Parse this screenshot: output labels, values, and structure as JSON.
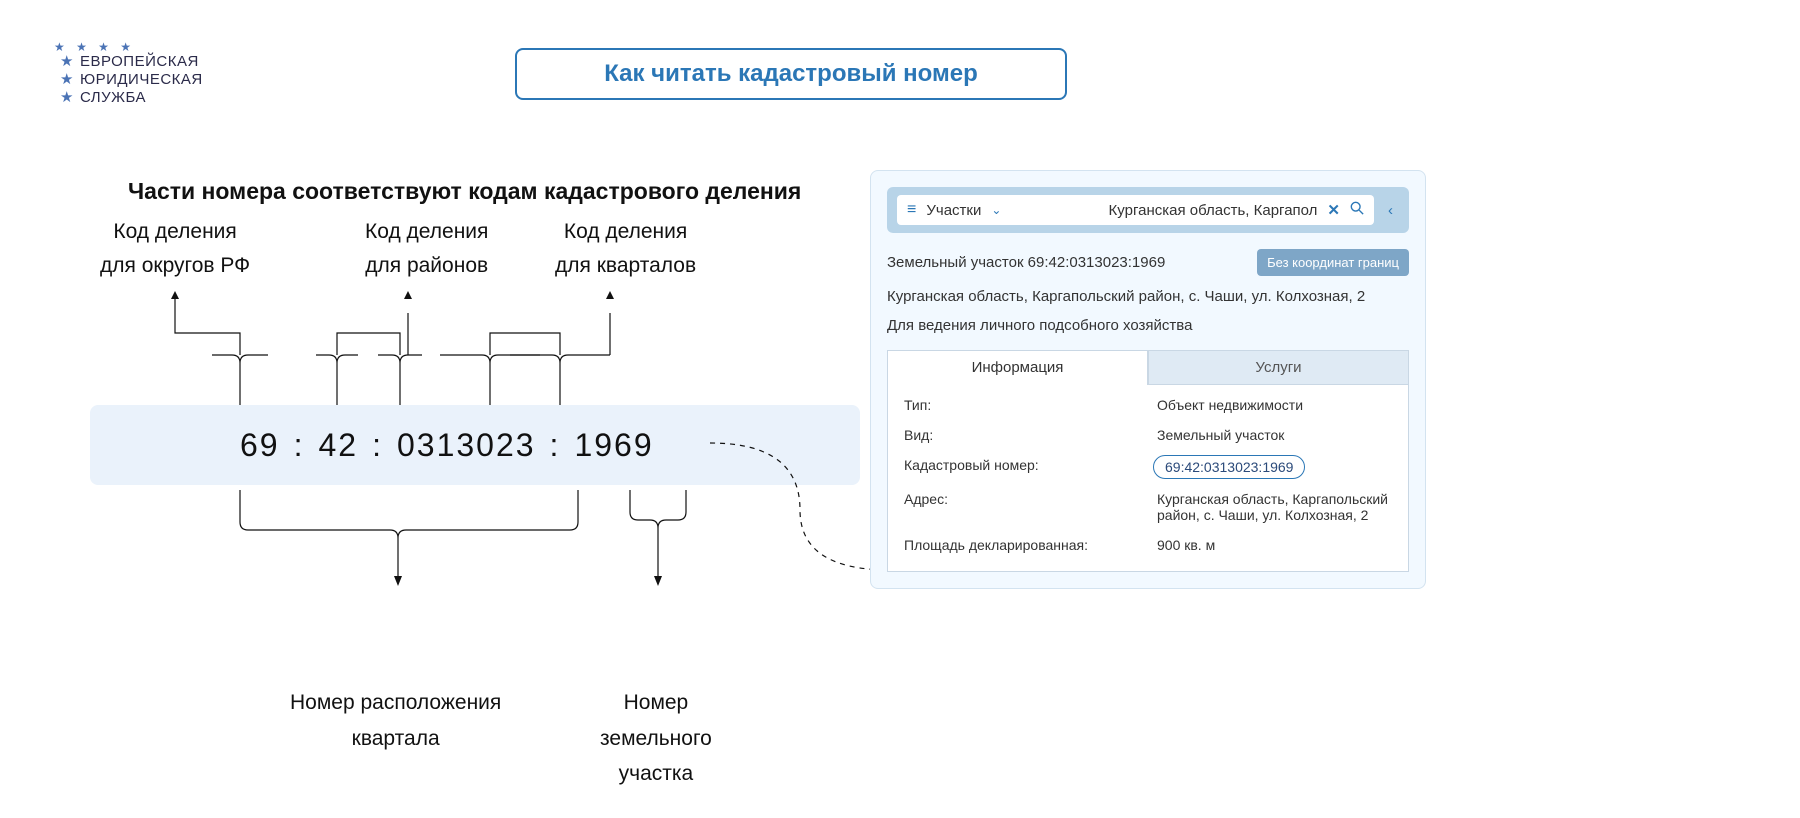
{
  "logo": {
    "line1": "ЕВРОПЕЙСКАЯ",
    "line2": "ЮРИДИЧЕСКАЯ",
    "line3": "СЛУЖБА"
  },
  "title": "Как читать кадастровый номер",
  "subtitle": "Части номера соответствуют кодам кадастрового деления",
  "labels_top": {
    "okrug": {
      "l1": "Код деления",
      "l2": "для округов РФ"
    },
    "raion": {
      "l1": "Код деления",
      "l2": "для районов"
    },
    "kvartal": {
      "l1": "Код деления",
      "l2": "для кварталов"
    }
  },
  "number": {
    "p1": "69",
    "p2": "42",
    "p3": "0313023",
    "p4": "1969",
    "sep": ":"
  },
  "labels_bottom": {
    "kvartal_loc": {
      "l1": "Номер расположения",
      "l2": "квартала"
    },
    "parcel": {
      "l1": "Номер",
      "l2": "земельного",
      "l3": "участка"
    }
  },
  "card": {
    "search": {
      "category": "Участки",
      "query": "Курганская область, Каргапол"
    },
    "header_title": "Земельный участок 69:42:0313023:1969",
    "badge": "Без координат границ",
    "address": "Курганская область, Каргапольский район, с. Чаши, ул. Колхозная, 2",
    "purpose": "Для ведения личного подсобного хозяйства",
    "tabs": {
      "info": "Информация",
      "services": "Услуги"
    },
    "rows": {
      "type_k": "Тип:",
      "type_v": "Объект недвижимости",
      "kind_k": "Вид:",
      "kind_v": "Земельный участок",
      "cad_k": "Кадастровый номер:",
      "cad_v": "69:42:0313023:1969",
      "addr_k": "Адрес:",
      "addr_v": "Курганская область, Каргапольский район, с. Чаши, ул. Колхозная, 2",
      "area_k": "Площадь декларированная:",
      "area_v": "900 кв. м"
    }
  }
}
